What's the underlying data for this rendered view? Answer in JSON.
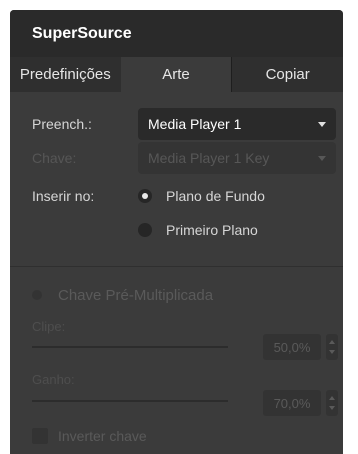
{
  "panel": {
    "title": "SuperSource"
  },
  "tabs": [
    {
      "label": "Predefinições",
      "active": false
    },
    {
      "label": "Arte",
      "active": true
    },
    {
      "label": "Copiar",
      "active": false
    }
  ],
  "fill": {
    "label": "Preench.:",
    "value": "Media Player 1"
  },
  "key": {
    "label": "Chave:",
    "value": "Media Player 1 Key",
    "enabled": false
  },
  "place_in": {
    "label": "Inserir no:",
    "options": [
      {
        "label": "Plano de Fundo",
        "selected": true
      },
      {
        "label": "Primeiro Plano",
        "selected": false
      }
    ]
  },
  "premultiplied": {
    "label": "Chave Pré-Multiplicada",
    "enabled": false
  },
  "clip": {
    "label": "Clipe:",
    "value": "50,0%"
  },
  "gain": {
    "label": "Ganho:",
    "value": "70,0%"
  },
  "invert": {
    "label": "Inverter chave"
  }
}
